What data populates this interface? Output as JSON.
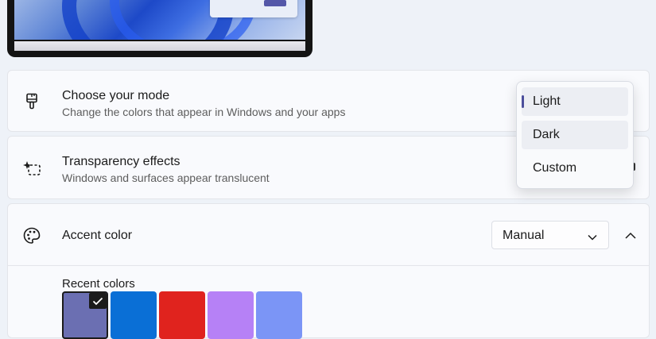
{
  "mode_card": {
    "title": "Choose your mode",
    "description": "Change the colors that appear in Windows and your apps",
    "icon": "brush-icon"
  },
  "transparency_card": {
    "title": "Transparency effects",
    "description": "Windows and surfaces appear translucent",
    "icon": "transparency-icon"
  },
  "accent_card": {
    "title": "Accent color",
    "icon": "palette-icon",
    "select_value": "Manual",
    "recent_colors_label": "Recent colors",
    "recent_colors": [
      "#6b6fb2",
      "#0a6fd6",
      "#e0231e",
      "#b681f6",
      "#7b95f6"
    ],
    "selected_index": 0
  },
  "mode_menu": {
    "options": [
      "Light",
      "Dark",
      "Custom"
    ],
    "selected": "Light",
    "accent": "#4c4f9c"
  }
}
